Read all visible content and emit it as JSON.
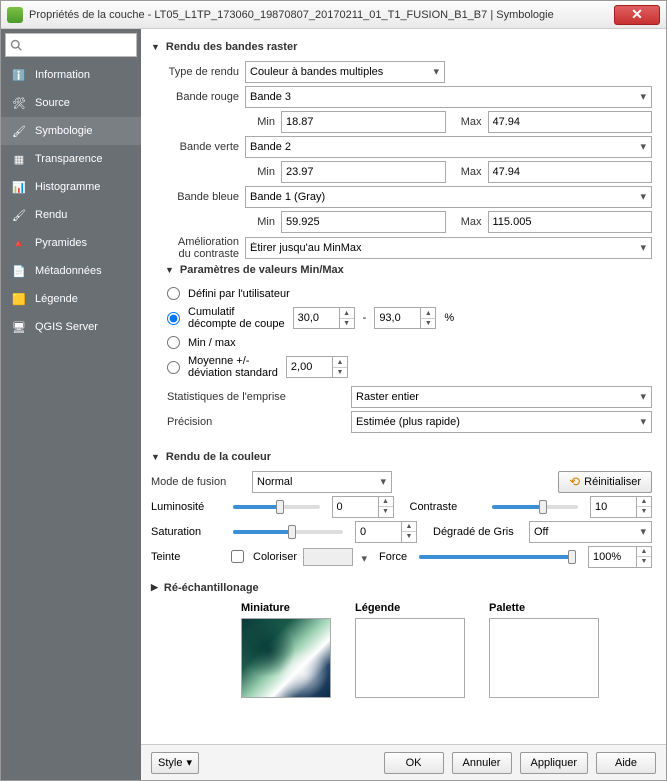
{
  "window": {
    "title": "Propriétés de la couche - LT05_L1TP_173060_19870807_20170211_01_T1_FUSION_B1_B7 | Symbologie"
  },
  "sidebar": {
    "items": [
      {
        "label": "Information"
      },
      {
        "label": "Source"
      },
      {
        "label": "Symbologie"
      },
      {
        "label": "Transparence"
      },
      {
        "label": "Histogramme"
      },
      {
        "label": "Rendu"
      },
      {
        "label": "Pyramides"
      },
      {
        "label": "Métadonnées"
      },
      {
        "label": "Légende"
      },
      {
        "label": "QGIS Server"
      }
    ]
  },
  "render": {
    "heading": "Rendu des bandes raster",
    "type_label": "Type de rendu",
    "type_value": "Couleur à bandes multiples",
    "red_label": "Bande rouge",
    "red_band": "Bande 3",
    "red_min_label": "Min",
    "red_min": "18.87",
    "red_max_label": "Max",
    "red_max": "47.94",
    "green_label": "Bande verte",
    "green_band": "Bande 2",
    "green_min_label": "Min",
    "green_min": "23.97",
    "green_max_label": "Max",
    "green_max": "47.94",
    "blue_label": "Bande bleue",
    "blue_band": "Bande 1 (Gray)",
    "blue_min_label": "Min",
    "blue_min": "59.925",
    "blue_max_label": "Max",
    "blue_max": "115.005",
    "contrast_label": "Amélioration\ndu contraste",
    "contrast_value": "Étirer jusqu'au MinMax"
  },
  "minmax": {
    "heading": "Paramètres de valeurs Min/Max",
    "user": "Défini par l'utilisateur",
    "cumul1": "Cumulatif",
    "cumul2": "décompte de coupe",
    "cumul_lo": "30,0",
    "cumul_hi": "93,0",
    "cumul_pct": "%",
    "dash": "-",
    "minmax": "Min / max",
    "mean1": "Moyenne +/-",
    "mean2": "déviation standard",
    "mean_val": "2,00",
    "stats_label": "Statistiques de l'emprise",
    "stats_value": "Raster entier",
    "prec_label": "Précision",
    "prec_value": "Estimée (plus rapide)"
  },
  "color": {
    "heading": "Rendu de la couleur",
    "blend_label": "Mode de fusion",
    "blend_value": "Normal",
    "reset": "Réinitialiser",
    "lum_label": "Luminosité",
    "lum_val": "0",
    "con_label": "Contraste",
    "con_val": "10",
    "sat_label": "Saturation",
    "sat_val": "0",
    "gray_label": "Dégradé de Gris",
    "gray_value": "Off",
    "hue_label": "Teinte",
    "colorize": "Coloriser",
    "force": "Force",
    "force_val": "100%"
  },
  "resample": {
    "heading": "Ré-échantillonage",
    "thumb": "Miniature",
    "legend": "Légende",
    "palette": "Palette"
  },
  "footer": {
    "style": "Style",
    "ok": "OK",
    "cancel": "Annuler",
    "apply": "Appliquer",
    "help": "Aide"
  }
}
